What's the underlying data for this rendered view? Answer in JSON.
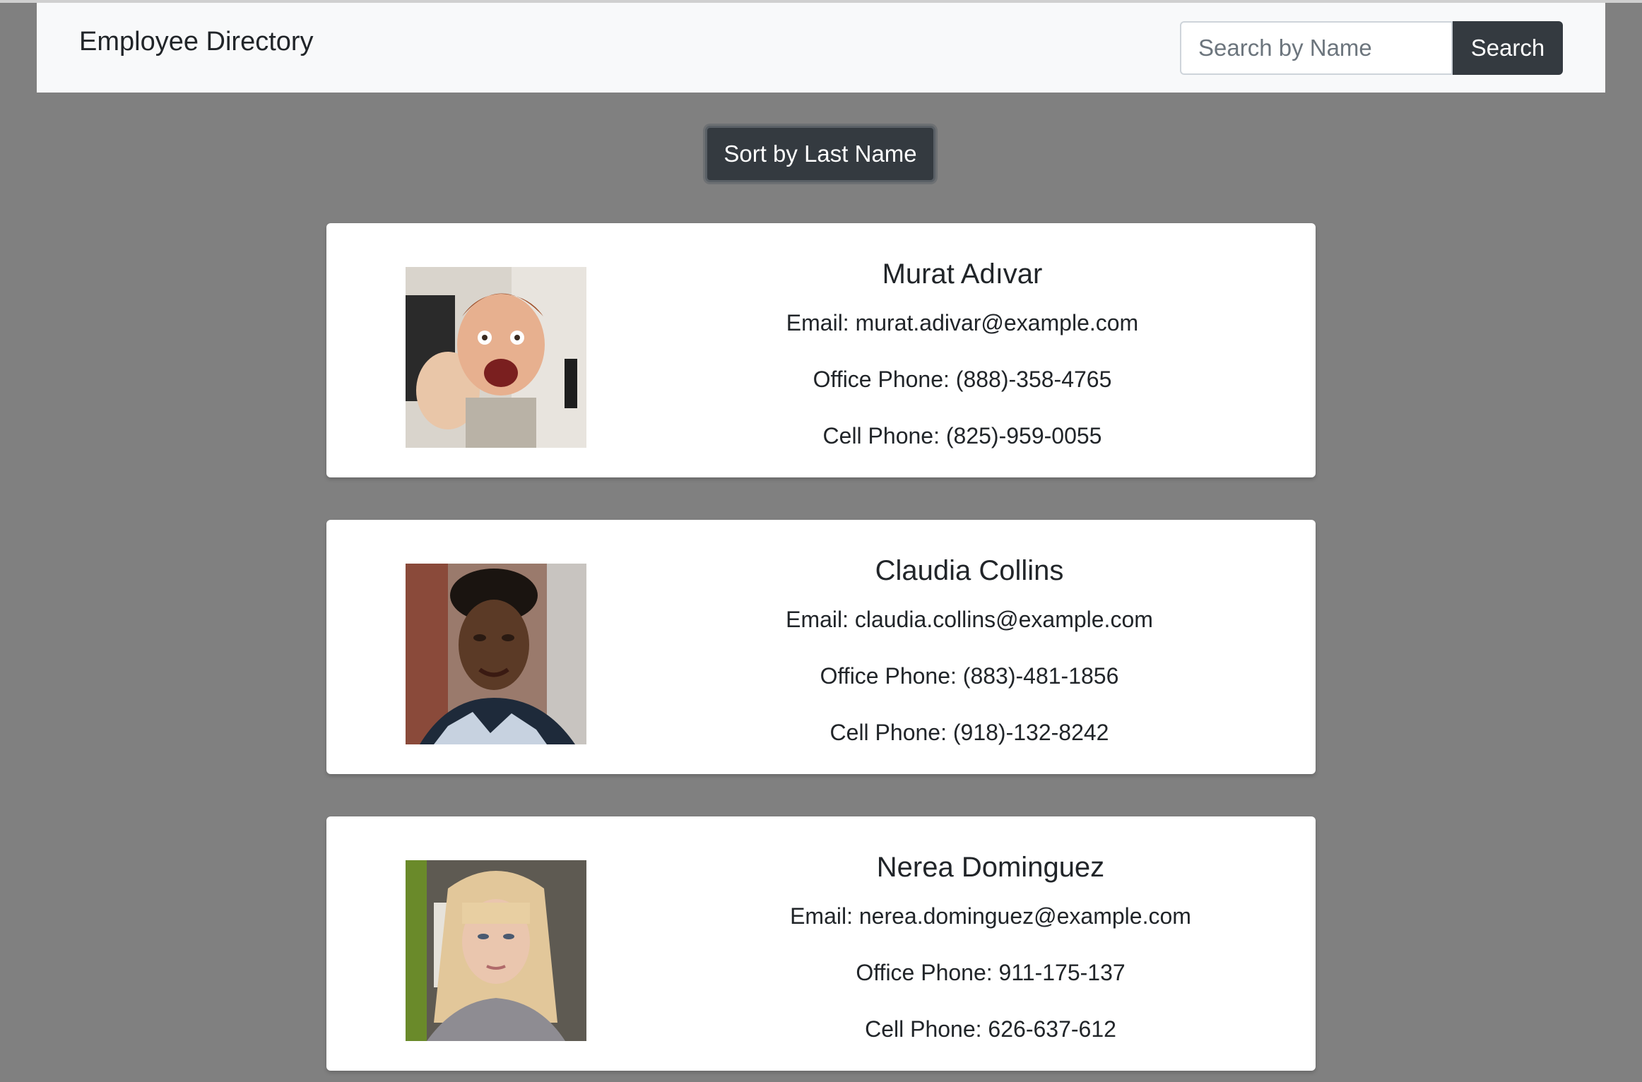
{
  "header": {
    "brand": "Employee Directory",
    "search_placeholder": "Search by Name",
    "search_value": "",
    "search_button": "Search"
  },
  "controls": {
    "sort_button": "Sort by Last Name"
  },
  "employees": [
    {
      "name": "Murat Adıvar",
      "email_label": "Email: murat.adivar@example.com",
      "office_label": "Office Phone: (888)-358-4765",
      "cell_label": "Cell Phone: (825)-959-0055"
    },
    {
      "name": "Claudia Collins",
      "email_label": "Email: claudia.collins@example.com",
      "office_label": "Office Phone: (883)-481-1856",
      "cell_label": "Cell Phone: (918)-132-8242"
    },
    {
      "name": "Nerea Dominguez",
      "email_label": "Email: nerea.dominguez@example.com",
      "office_label": "Office Phone: 911-175-137",
      "cell_label": "Cell Phone: 626-637-612"
    }
  ],
  "colors": {
    "page_background": "#808080",
    "navbar_background": "#f8f9fa",
    "dark_button": "#343a40",
    "card_background": "#ffffff"
  }
}
